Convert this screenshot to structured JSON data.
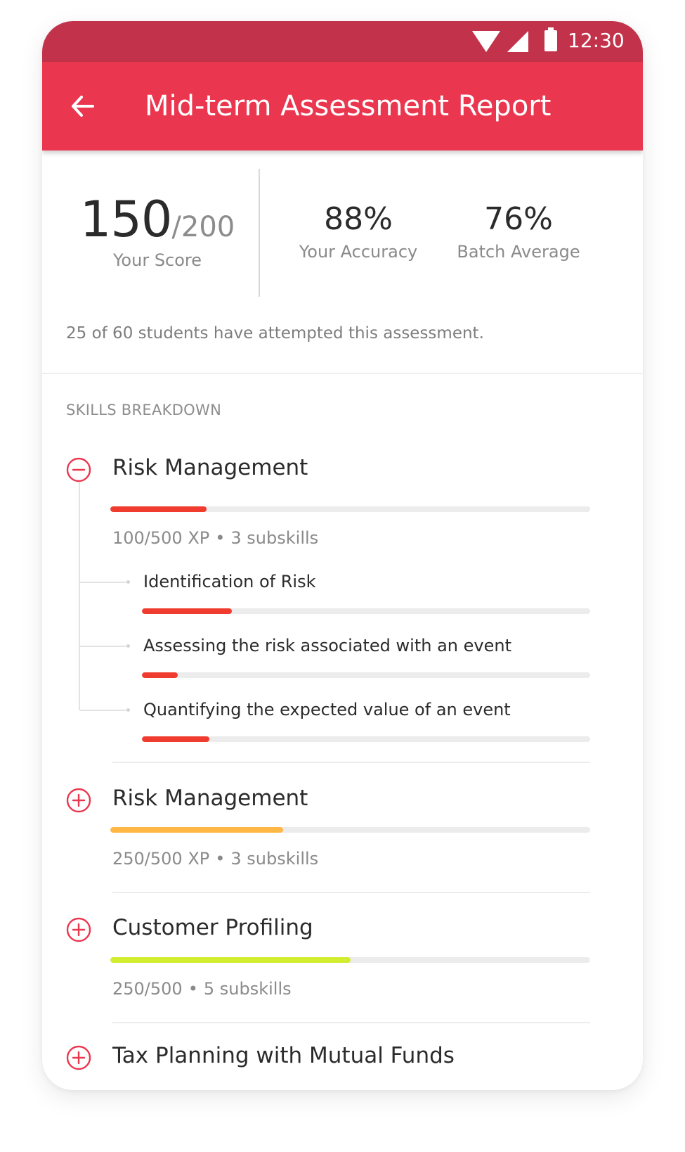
{
  "status_bar": {
    "time": "12:30",
    "icons": [
      "wifi-icon",
      "signal-icon",
      "battery-icon"
    ]
  },
  "app_bar": {
    "title": "Mid-term Assessment Report",
    "back_icon": "back-arrow-icon"
  },
  "summary": {
    "score": "150",
    "score_total": "/200",
    "score_label": "Your Score",
    "accuracy": "88%",
    "accuracy_label": "Your Accuracy",
    "batch_average": "76%",
    "batch_average_label": "Batch Average",
    "attempt_text": "25 of 60 students have attempted this assessment."
  },
  "skills": {
    "header": "SKILLS BREAKDOWN",
    "items": [
      {
        "title": "Risk Management",
        "expanded": true,
        "toggle_icon": "minus-circle-icon",
        "progress": 0.2,
        "bar_color": "#f03c2e",
        "xp": "100/500 XP",
        "separator": "•",
        "subskills_label": "3 subskills",
        "subskills": [
          {
            "title": "Identification of Risk",
            "progress": 0.2
          },
          {
            "title": "Assessing the risk associated with an event",
            "progress": 0.08
          },
          {
            "title": "Quantifying the expected value of an event",
            "progress": 0.15
          }
        ]
      },
      {
        "title": "Risk Management",
        "expanded": false,
        "toggle_icon": "plus-circle-icon",
        "progress": 0.36,
        "bar_color": "#ffb845",
        "xp": "250/500 XP",
        "separator": "•",
        "subskills_label": "3 subskills"
      },
      {
        "title": "Customer Profiling",
        "expanded": false,
        "toggle_icon": "plus-circle-icon",
        "progress": 0.5,
        "bar_color": "#d2ec2e",
        "xp": "250/500",
        "separator": "•",
        "subskills_label": "5 subskills"
      },
      {
        "title": "Tax Planning with Mutual Funds",
        "expanded": false,
        "toggle_icon": "plus-circle-icon"
      }
    ]
  },
  "colors": {
    "status_bar": "#c2334b",
    "app_bar": "#ea374f",
    "accent": "#ea374f",
    "track": "#ececec"
  }
}
